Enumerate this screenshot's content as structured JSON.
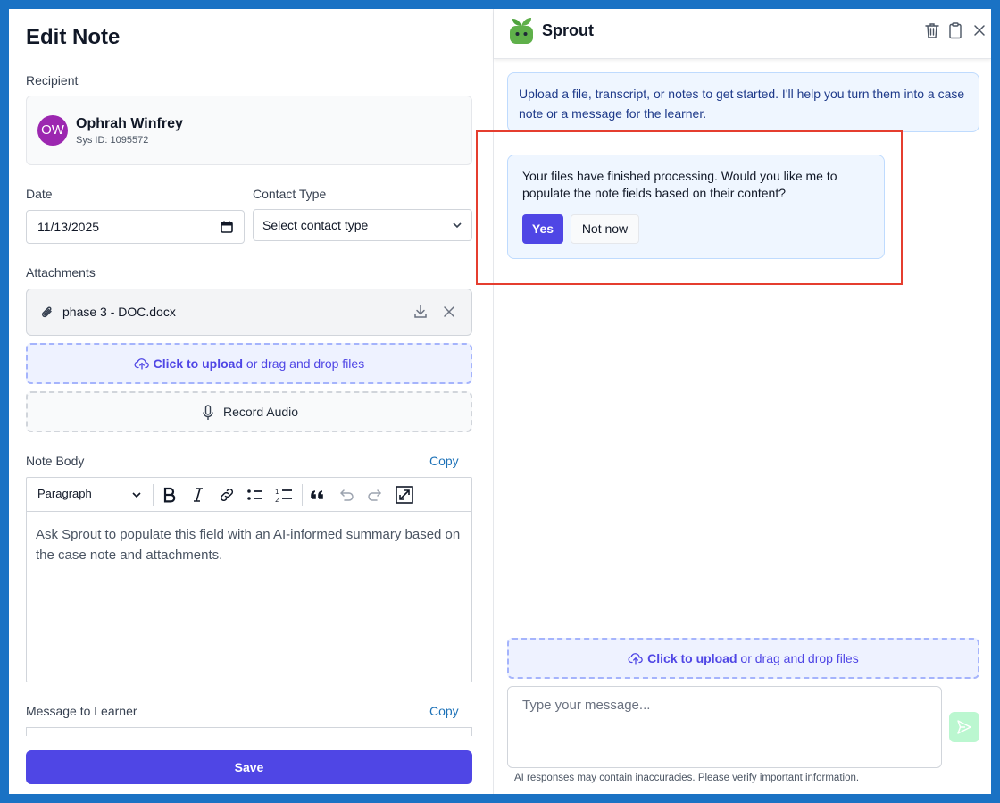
{
  "left": {
    "title": "Edit Note",
    "recipient_label": "Recipient",
    "recipient": {
      "initials": "OW",
      "name": "Ophrah Winfrey",
      "sys_id": "Sys ID: 1095572",
      "avatar_color": "#9c27b0"
    },
    "date_label": "Date",
    "date_value": "11/13/2025",
    "contact_type_label": "Contact Type",
    "contact_type_value": "Select contact type",
    "attachments_label": "Attachments",
    "attachment": {
      "file_name": "phase 3 - DOC.docx",
      "icon": "paperclip-icon"
    },
    "upload": {
      "link": "Click to upload",
      "rest": " or drag and drop files",
      "icon": "cloud-upload-icon"
    },
    "record_audio": "Record Audio",
    "note_body_label": "Note Body",
    "copy_label": "Copy",
    "editor": {
      "block_format": "Paragraph",
      "tools": [
        "bold-icon",
        "italic-icon",
        "link-icon",
        "bullet-list-icon",
        "numbered-list-icon",
        "blockquote-icon",
        "undo-icon",
        "redo-icon",
        "fullscreen-icon"
      ],
      "content": "Ask Sprout to populate this field with an AI-informed summary based on the case note and attachments."
    },
    "message_label": "Message to Learner",
    "message_copy_label": "Copy",
    "save_label": "Save"
  },
  "chat": {
    "brand": "Sprout",
    "header_icons": [
      "trash-icon",
      "clipboard-icon",
      "close-icon"
    ],
    "intro_message": "Upload a file, transcript, or notes to get started. I'll help you turn them into a case note or a message for the learner.",
    "prompt_message": "Your files have finished processing. Would you like me to populate the note fields based on their content?",
    "yes_label": "Yes",
    "no_label": "Not now",
    "upload": {
      "link": "Click to upload",
      "rest": " or drag and drop files"
    },
    "input_placeholder": "Type your message...",
    "disclaimer": "AI responses may contain inaccuracies. Please verify important information."
  },
  "colors": {
    "accent": "#4f46e5",
    "frame": "#1a72c4",
    "highlight": "#e53e2f",
    "brand_green": "#5fb04a"
  }
}
